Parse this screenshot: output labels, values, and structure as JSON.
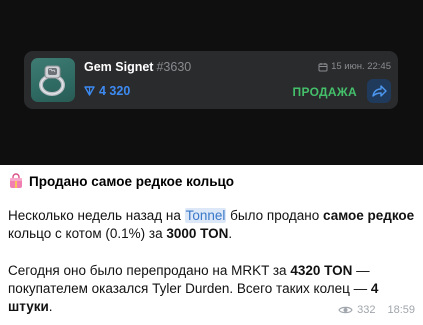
{
  "gift_card": {
    "name": "Gem Signet",
    "number": "#3630",
    "date": "15 июн. 22:45",
    "price": "4 320",
    "status": "ПРОДАЖА",
    "colors": {
      "card_bg": "#2a2b2d",
      "price": "#3d8bf2",
      "status": "#44c06a",
      "thumb": "#3e7c73"
    }
  },
  "message": {
    "title_icon": "shopping-bag-icon",
    "title": "Продано самое редкое кольцо",
    "p1": {
      "a": "Несколько недель назад на ",
      "link": "Tonnel",
      "b": " было продано ",
      "bold1": "самое редкое",
      "c": " кольцо с котом (0.1%) за ",
      "bold2": "3000 TON",
      "d": "."
    },
    "p2": {
      "a": "Сегодня оно было перепродано на MRKT за ",
      "bold1": "4320 TON",
      "b": " — покупателем оказался Tyler Durden. Всего таких колец — ",
      "bold2": "4 штуки",
      "c": "."
    },
    "views": "332",
    "time": "18:59"
  }
}
